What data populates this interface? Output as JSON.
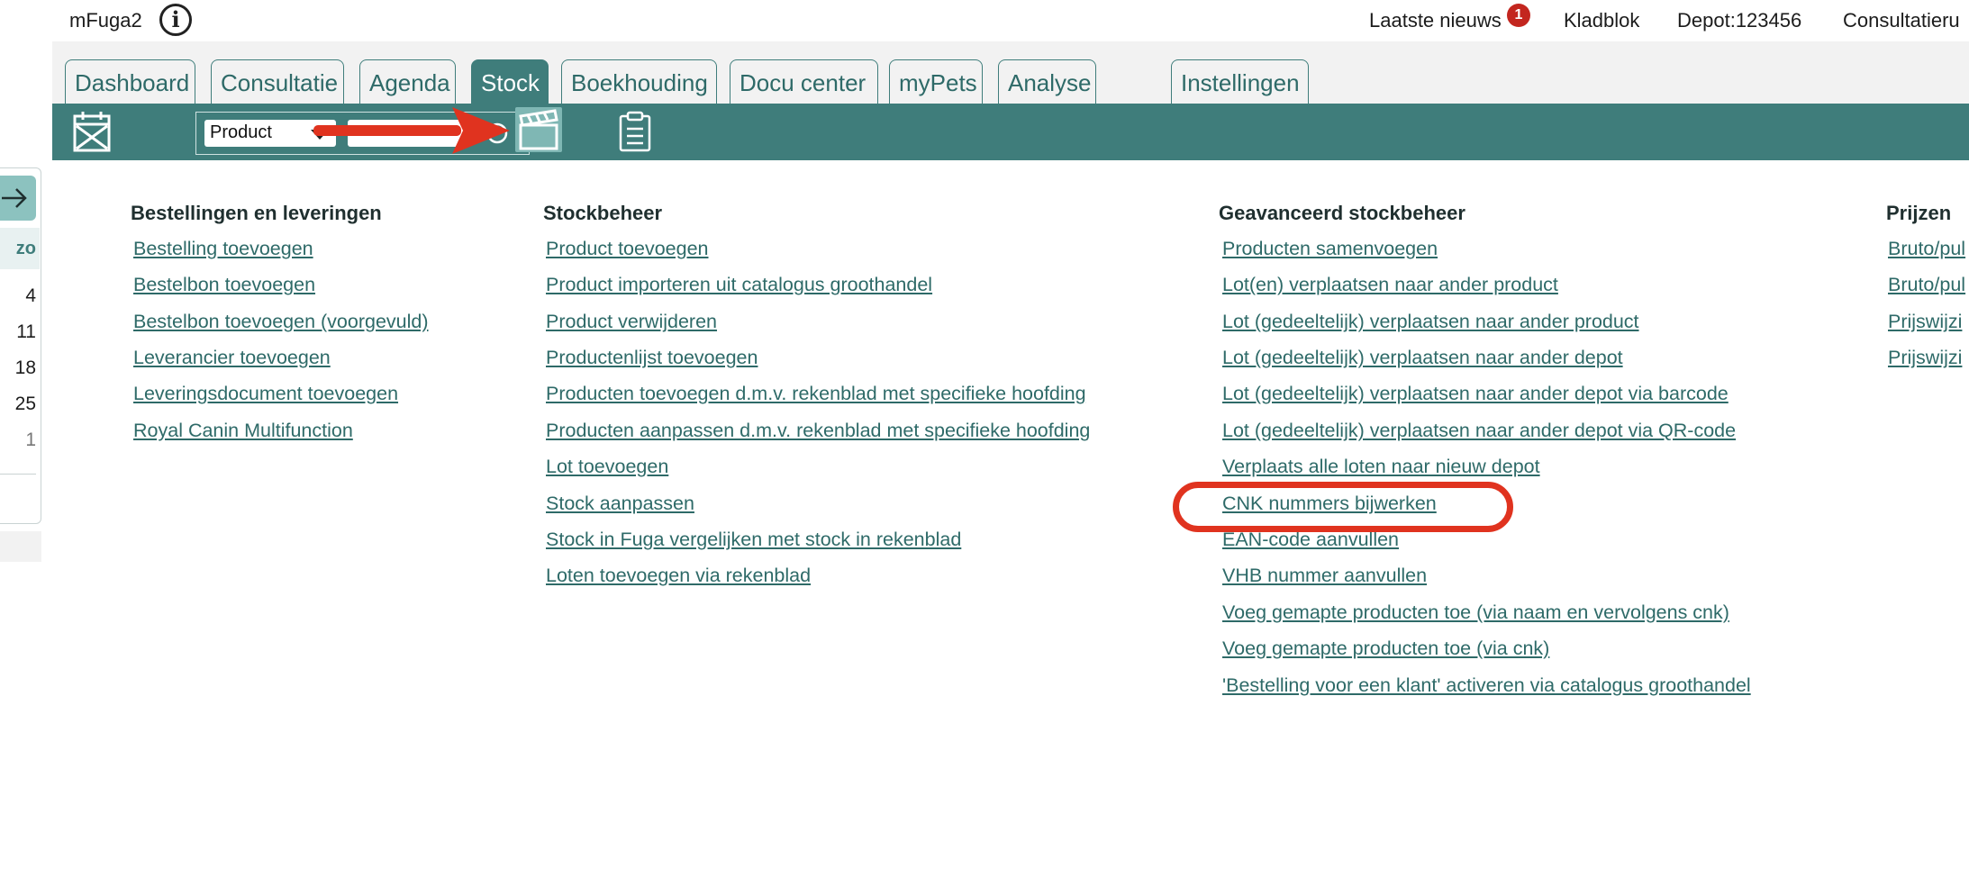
{
  "app": {
    "title": "mFuga2"
  },
  "topnav": {
    "news_label": "Laatste nieuws",
    "news_badge": "1",
    "notepad_label": "Kladblok",
    "depot_label": "Depot:123456",
    "consultation_label": "Consultatieru"
  },
  "tabs": [
    {
      "label": "Dashboard",
      "active": false
    },
    {
      "label": "Consultatie",
      "active": false
    },
    {
      "label": "Agenda",
      "active": false
    },
    {
      "label": "Stock",
      "active": true
    },
    {
      "label": "Boekhouding",
      "active": false
    },
    {
      "label": "Docu center",
      "active": false
    },
    {
      "label": "myPets",
      "active": false
    },
    {
      "label": "Analyse",
      "active": false
    },
    {
      "label": "Instellingen",
      "active": false
    }
  ],
  "toolbar": {
    "search_type_selected": "Product",
    "search_value": ""
  },
  "icons": {
    "info": "info-icon",
    "calendar": "calendar-icon",
    "search": "search-icon",
    "clapper": "clapperboard-icon",
    "clipboard": "clipboard-icon",
    "arrow": "arrow-right-icon"
  },
  "colors": {
    "accent": "#3f7d7b",
    "link": "#2e6a68",
    "highlight": "#e0331f",
    "badge": "#c3261f"
  },
  "left_calendar": {
    "day_header": "zo",
    "days": [
      "4",
      "11",
      "18",
      "25",
      "1"
    ]
  },
  "columns": {
    "orders": {
      "heading": "Bestellingen en leveringen",
      "links": [
        "Bestelling toevoegen",
        "Bestelbon toevoegen",
        "Bestelbon toevoegen (voorgevuld)",
        "Leverancier toevoegen",
        "Leveringsdocument toevoegen",
        "Royal Canin Multifunction"
      ]
    },
    "stock": {
      "heading": "Stockbeheer",
      "links": [
        "Product toevoegen",
        "Product importeren uit catalogus groothandel",
        "Product verwijderen",
        "Productenlijst toevoegen",
        "Producten toevoegen d.m.v. rekenblad met specifieke hoofding",
        "Producten aanpassen d.m.v. rekenblad met specifieke hoofding",
        "Lot toevoegen",
        "Stock aanpassen",
        "Stock in Fuga vergelijken met stock in rekenblad",
        "Loten toevoegen via rekenblad"
      ]
    },
    "advanced": {
      "heading": "Geavanceerd stockbeheer",
      "links": [
        "Producten samenvoegen",
        "Lot(en) verplaatsen naar ander product",
        "Lot (gedeeltelijk) verplaatsen naar ander product",
        "Lot (gedeeltelijk) verplaatsen naar ander depot",
        "Lot (gedeeltelijk) verplaatsen naar ander depot via barcode",
        "Lot (gedeeltelijk) verplaatsen naar ander depot via QR-code",
        "Verplaats alle loten naar nieuw depot",
        "CNK nummers bijwerken",
        "EAN-code aanvullen",
        "VHB nummer aanvullen",
        "Voeg gemapte producten toe (via naam en vervolgens cnk)",
        "Voeg gemapte producten toe (via cnk)",
        "'Bestelling voor een klant' activeren via catalogus groothandel"
      ]
    },
    "prices": {
      "heading": "Prijzen",
      "links": [
        "Bruto/pul",
        "Bruto/pul",
        "Prijswijzi",
        "Prijswijzi"
      ]
    }
  }
}
